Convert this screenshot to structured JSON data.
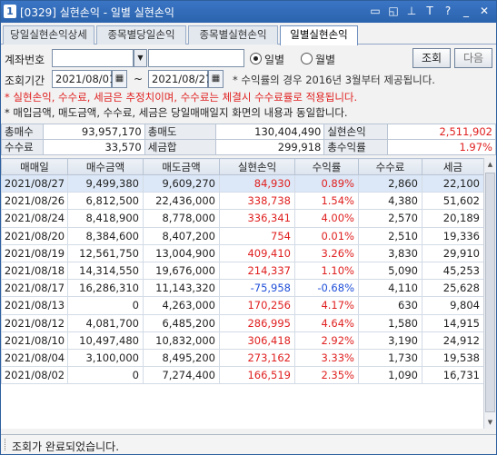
{
  "window": {
    "number": "1",
    "title": "[0329] 실현손익 - 일별 실현손익"
  },
  "titlebar_icons": [
    "restore-icon",
    "new-window-icon",
    "pin-icon",
    "font-icon",
    "help-icon",
    "minimize-icon",
    "close-icon"
  ],
  "titlebar_glyphs": {
    "restore": "▭",
    "newwin": "◱",
    "pin": "⊥",
    "font": "T",
    "help": "?",
    "min": "_",
    "close": "✕"
  },
  "tabs": [
    {
      "label": "당일실현손익상세"
    },
    {
      "label": "종목별당일손익"
    },
    {
      "label": "종목별실현손익"
    },
    {
      "label": "일별실현손익",
      "active": true
    }
  ],
  "filters": {
    "account_label": "계좌번호",
    "account_value": "",
    "period_label": "조회기간",
    "date_from": "2021/08/01",
    "date_to": "2021/08/27",
    "tilde": "~",
    "daily_label": "일별",
    "monthly_label": "월별",
    "search_button": "조회",
    "next_button": "다음",
    "rate_note": "* 수익률의 경우 2016년 3월부터 제공됩니다."
  },
  "notices": {
    "line1": "* 실현손익, 수수료, 세금은 추정치이며, 수수료는 체결시 수수료률로 적용됩니다.",
    "line2": "* 매입금액, 매도금액, 수수료, 세금은 당일매매일지 화면의 내용과 동일합니다."
  },
  "summary": {
    "total_buy_label": "총매수",
    "total_buy": "93,957,170",
    "total_sell_label": "총매도",
    "total_sell": "130,404,490",
    "realized_label": "실현손익",
    "realized": "2,511,902",
    "fee_label": "수수료",
    "fee": "33,570",
    "tax_label": "세금합",
    "tax": "299,918",
    "total_rate_label": "총수익률",
    "total_rate": "1.97%"
  },
  "grid": {
    "headers": [
      "매매일",
      "매수금액",
      "매도금액",
      "실현손익",
      "수익률",
      "수수료",
      "세금"
    ],
    "rows": [
      {
        "date": "2021/08/27",
        "buy": "9,499,380",
        "sell": "9,609,270",
        "pnl": "84,930",
        "rate": "0.89%",
        "fee": "2,860",
        "tax": "22,100",
        "sign": "pos"
      },
      {
        "date": "2021/08/26",
        "buy": "6,812,500",
        "sell": "22,436,000",
        "pnl": "338,738",
        "rate": "1.54%",
        "fee": "4,380",
        "tax": "51,602",
        "sign": "pos"
      },
      {
        "date": "2021/08/24",
        "buy": "8,418,900",
        "sell": "8,778,000",
        "pnl": "336,341",
        "rate": "4.00%",
        "fee": "2,570",
        "tax": "20,189",
        "sign": "pos"
      },
      {
        "date": "2021/08/20",
        "buy": "8,384,600",
        "sell": "8,407,200",
        "pnl": "754",
        "rate": "0.01%",
        "fee": "2,510",
        "tax": "19,336",
        "sign": "pos"
      },
      {
        "date": "2021/08/19",
        "buy": "12,561,750",
        "sell": "13,004,900",
        "pnl": "409,410",
        "rate": "3.26%",
        "fee": "3,830",
        "tax": "29,910",
        "sign": "pos"
      },
      {
        "date": "2021/08/18",
        "buy": "14,314,550",
        "sell": "19,676,000",
        "pnl": "214,337",
        "rate": "1.10%",
        "fee": "5,090",
        "tax": "45,253",
        "sign": "pos"
      },
      {
        "date": "2021/08/17",
        "buy": "16,286,310",
        "sell": "11,143,320",
        "pnl": "-75,958",
        "rate": "-0.68%",
        "fee": "4,110",
        "tax": "25,628",
        "sign": "neg"
      },
      {
        "date": "2021/08/13",
        "buy": "0",
        "sell": "4,263,000",
        "pnl": "170,256",
        "rate": "4.17%",
        "fee": "630",
        "tax": "9,804",
        "sign": "pos"
      },
      {
        "date": "2021/08/12",
        "buy": "4,081,700",
        "sell": "6,485,200",
        "pnl": "286,995",
        "rate": "4.64%",
        "fee": "1,580",
        "tax": "14,915",
        "sign": "pos"
      },
      {
        "date": "2021/08/10",
        "buy": "10,497,480",
        "sell": "10,832,000",
        "pnl": "306,418",
        "rate": "2.92%",
        "fee": "3,190",
        "tax": "24,912",
        "sign": "pos"
      },
      {
        "date": "2021/08/04",
        "buy": "3,100,000",
        "sell": "8,495,200",
        "pnl": "273,162",
        "rate": "3.33%",
        "fee": "1,730",
        "tax": "19,538",
        "sign": "pos"
      },
      {
        "date": "2021/08/02",
        "buy": "0",
        "sell": "7,274,400",
        "pnl": "166,519",
        "rate": "2.35%",
        "fee": "1,090",
        "tax": "16,731",
        "sign": "pos"
      }
    ]
  },
  "status": {
    "message": "조회가 완료되었습니다."
  },
  "colors": {
    "positive": "#e02020",
    "negative": "#1f4fd8",
    "title_bar": "#2b63ad"
  }
}
